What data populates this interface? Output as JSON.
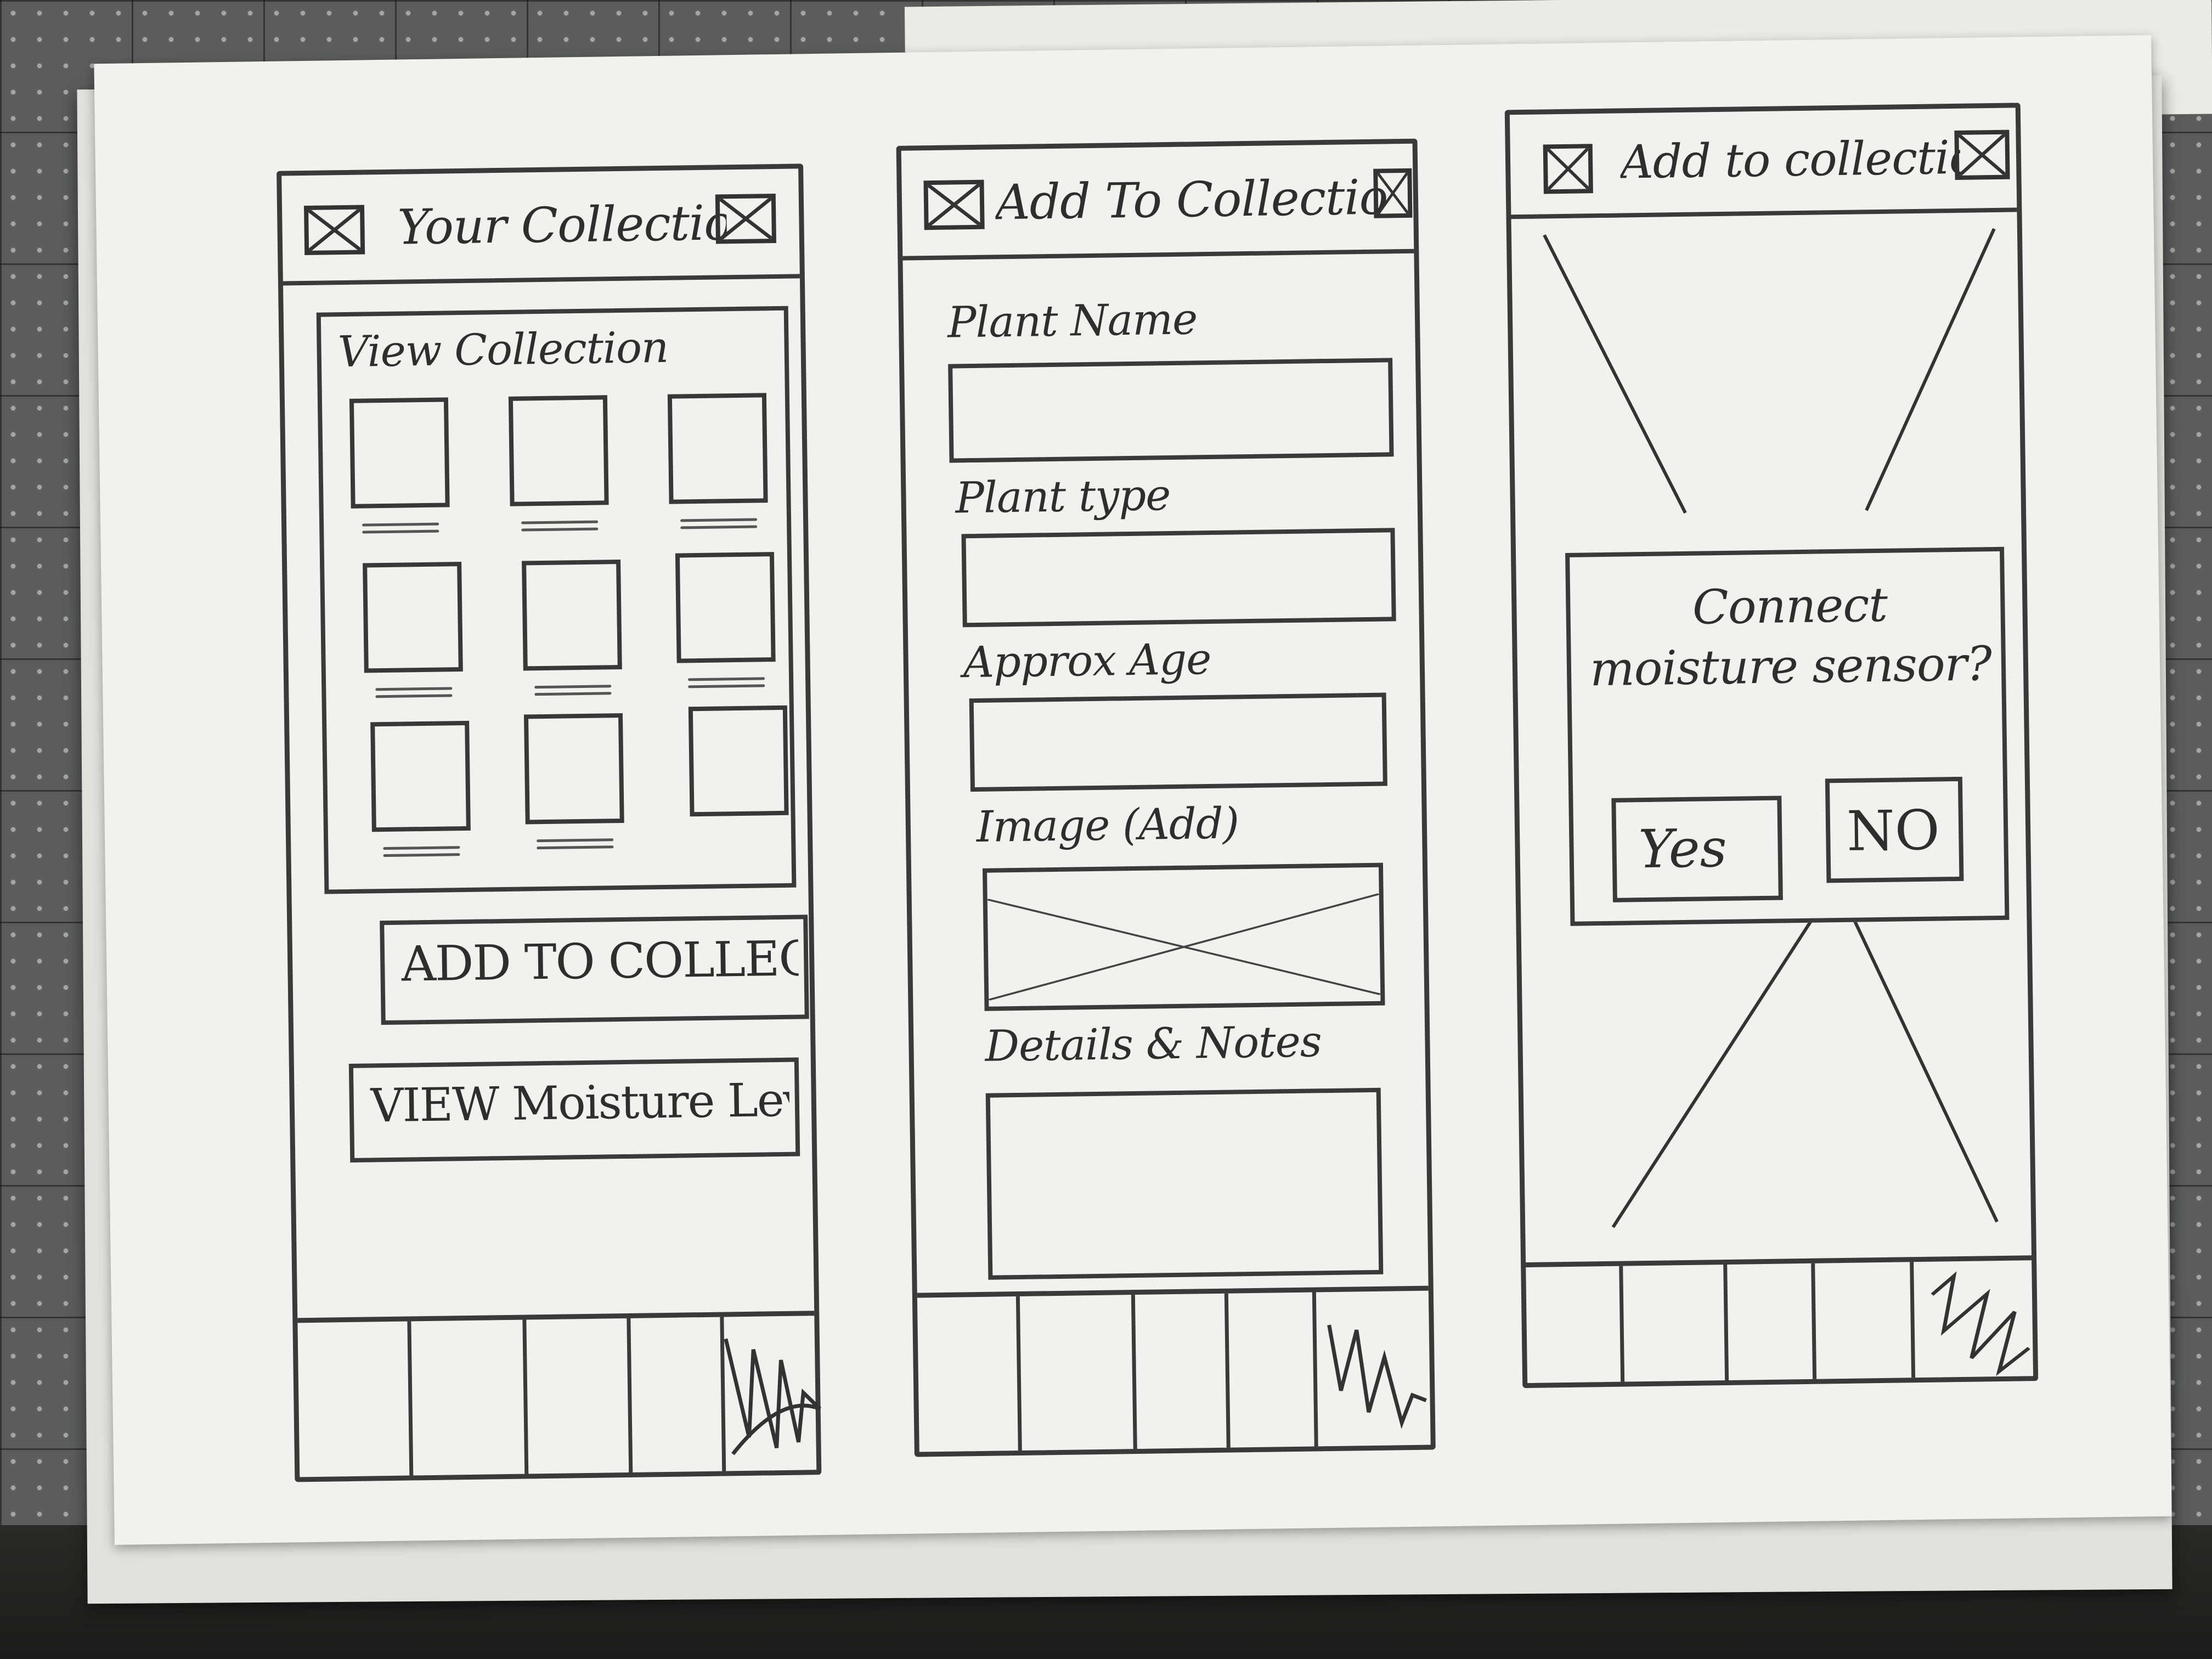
{
  "screens": {
    "collection": {
      "title": "Your Collection",
      "section_title": "View Collection",
      "add_button": "ADD TO COLLECTION",
      "moisture_button": "VIEW Moisture Levels"
    },
    "add": {
      "title": "Add To Collection",
      "fields": {
        "plant_name": "Plant Name",
        "plant_type": "Plant type",
        "approx_age": "Approx Age",
        "image": "Image (Add)",
        "details": "Details & Notes"
      }
    },
    "sensor": {
      "title": "Add to collection",
      "dialog_text": "Connect moisture sensor?",
      "yes_label": "Yes",
      "no_label": "NO"
    }
  },
  "icons": {
    "header_left": "placeholder-x-icon",
    "header_right": "placeholder-x-icon",
    "nav_active": "scribble-icon"
  },
  "colors": {
    "pencil": "#3a3a3a",
    "paper": "#f2f1ee"
  }
}
